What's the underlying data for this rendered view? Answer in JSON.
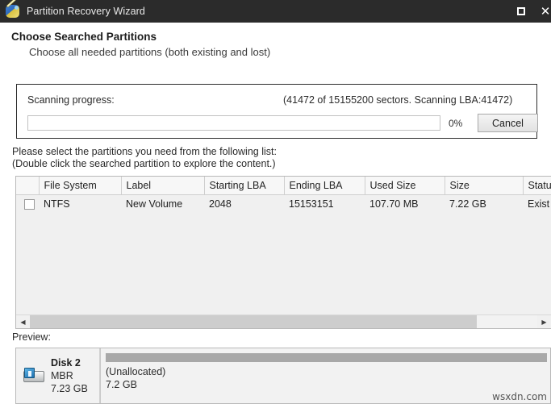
{
  "window": {
    "title": "Partition Recovery Wizard",
    "icon": "wizard-wand-icon",
    "controls": {
      "maximize": "maximize-icon",
      "close": "close-icon"
    }
  },
  "header": {
    "title": "Choose Searched Partitions",
    "subtitle": "Choose all needed partitions (both existing and lost)"
  },
  "scanning": {
    "label": "Scanning progress:",
    "status": "(41472 of 15155200 sectors. Scanning LBA:41472)",
    "percent_label": "0%",
    "percent_value": 0,
    "cancel_label": "Cancel"
  },
  "instructions": {
    "line1": "Please select the partitions you need from the following list:",
    "line2": "(Double click the searched partition to explore the content.)"
  },
  "table": {
    "columns": [
      "",
      "File System",
      "Label",
      "Starting LBA",
      "Ending LBA",
      "Used Size",
      "Size",
      "Statu"
    ],
    "rows": [
      {
        "checked": false,
        "file_system": "NTFS",
        "label": "New Volume",
        "starting_lba": "2048",
        "ending_lba": "15153151",
        "used_size": "107.70 MB",
        "size": "7.22 GB",
        "status": "Exist"
      }
    ],
    "scrollbar": {
      "left_arrow": "scroll-left-icon",
      "right_arrow": "scroll-right-icon",
      "thumb_percent": 88
    }
  },
  "preview": {
    "label": "Preview:",
    "disk": {
      "icon": "disk-drive-icon",
      "name": "Disk 2",
      "scheme": "MBR",
      "capacity": "7.23 GB"
    },
    "partitions": [
      {
        "name": "(Unallocated)",
        "size": "7.2 GB",
        "bar_percent": 100
      }
    ]
  },
  "watermark": "wsxdn.com",
  "colors": {
    "titlebar": "#2b2b2b",
    "panel_border": "#2c2c2c",
    "table_bg": "#f0f0f0",
    "unallocated_bar": "#a8a8a8",
    "scrollbar_thumb": "#cdcdcd"
  }
}
